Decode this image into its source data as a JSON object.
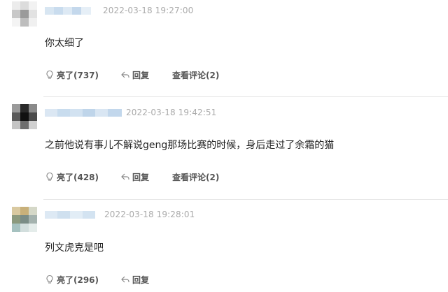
{
  "comments": [
    {
      "timestamp": "2022-03-18 19:27:00",
      "text": "你太细了",
      "like_label": "亮了(737)",
      "reply_label": "回复",
      "view_replies_label": "查看评论(2)",
      "avatar_colors": [
        "#ececec",
        "#dcdcdc",
        "#f2f2f2",
        "#c8c8c8",
        "#9a9a9a",
        "#e2e2e2",
        "#f4f4f4",
        "#bdbdbd",
        "#f0f0f0"
      ],
      "username_colors": [
        "#d8e6f2",
        "#c9dcee",
        "#dde9f4",
        "#c4d8ec",
        "#e6eff7"
      ]
    },
    {
      "timestamp": "2022-03-18 19:42:51",
      "text": "之前他说有事儿不解说geng那场比赛的时候，身后走过了余霜的猫",
      "like_label": "亮了(428)",
      "reply_label": "回复",
      "view_replies_label": "查看评论(2)",
      "avatar_colors": [
        "#9a9a9a",
        "#2a2a2a",
        "#8a8a8a",
        "#5a5a5a",
        "#111111",
        "#4a4a4a",
        "#c4c4c4",
        "#6e6e6e",
        "#d0d0d0"
      ],
      "username_colors": [
        "#dbe7f3",
        "#c8dcee",
        "#d2e2f1",
        "#bfd5ea",
        "#d9e6f3",
        "#c2d7ec"
      ]
    },
    {
      "timestamp": "2022-03-18 19:28:01",
      "text": "列文虎克是吧",
      "like_label": "亮了(296)",
      "reply_label": "回复",
      "view_replies_label": "",
      "avatar_colors": [
        "#d9c9a0",
        "#c8b07a",
        "#d5d8c8",
        "#8c9a7e",
        "#7a8c86",
        "#a4b2ae",
        "#a6c2c0",
        "#d2dedd",
        "#e4ecea"
      ],
      "username_colors": [
        "#dde9f4",
        "#cfe0ef",
        "#e2edf6",
        "#d3e3f1"
      ]
    }
  ],
  "colors": {
    "timestamp": "#aaaaaa",
    "text": "#222222",
    "action_text": "#555555",
    "divider": "#e6e6e6"
  }
}
